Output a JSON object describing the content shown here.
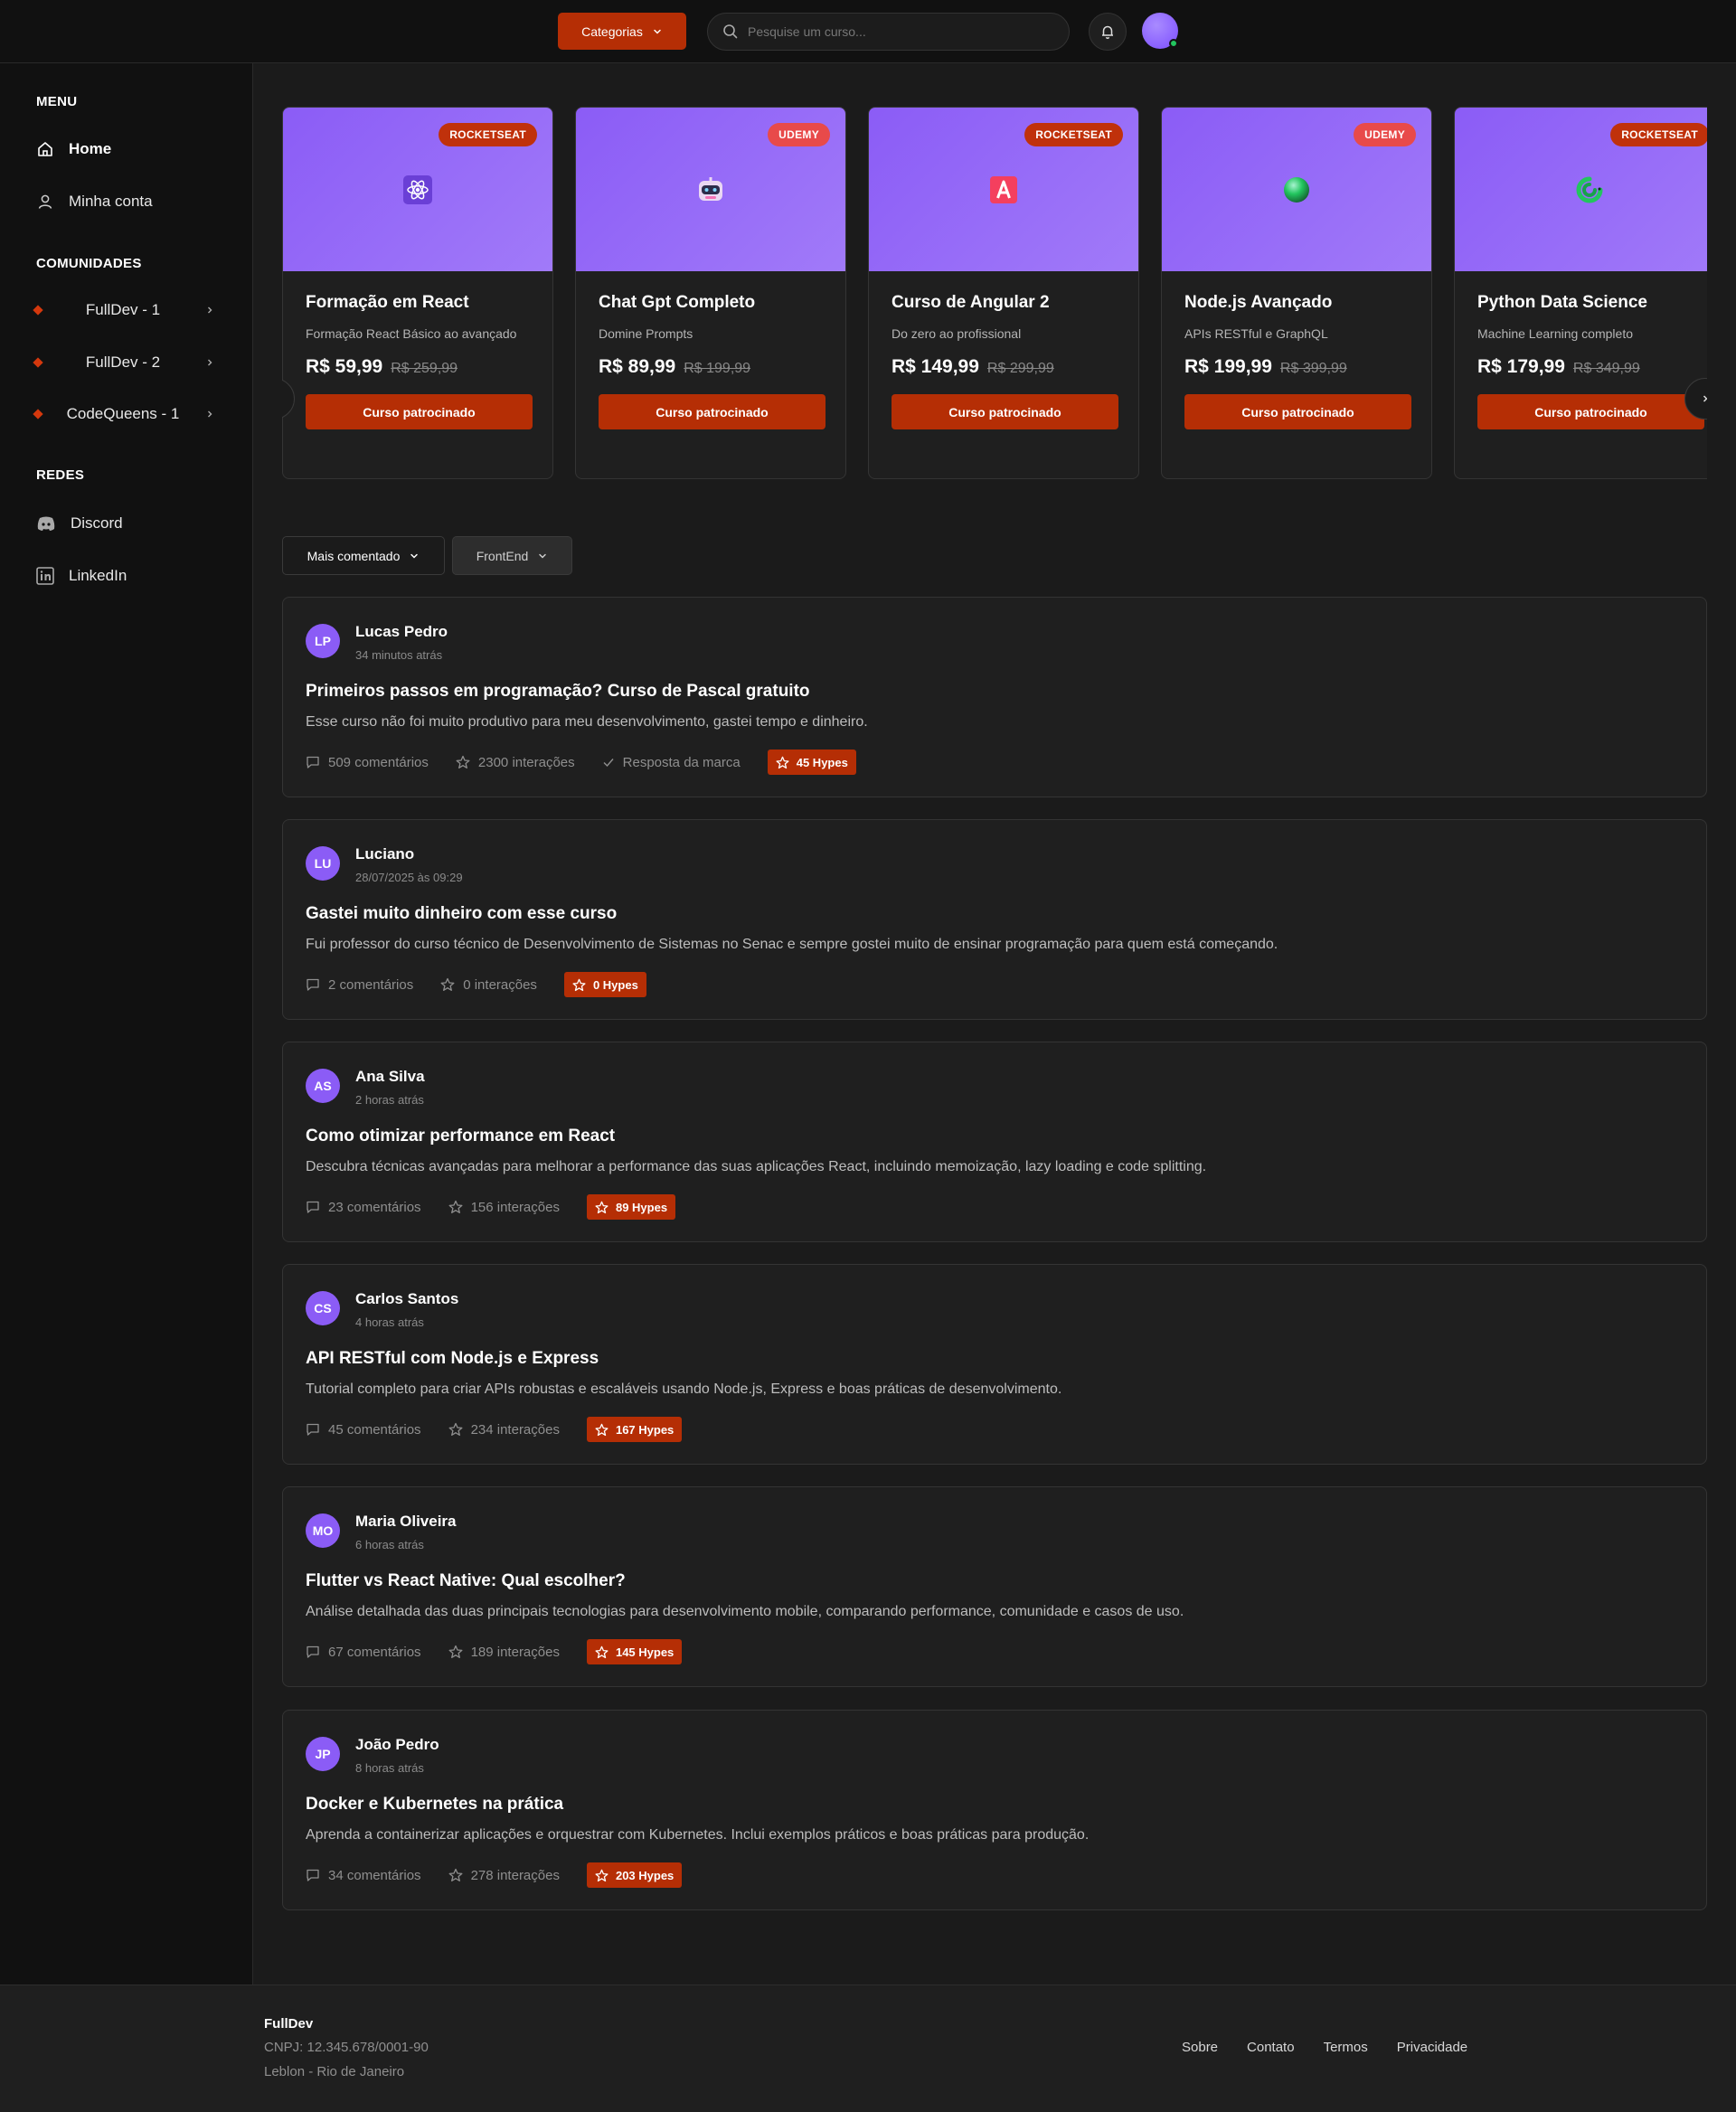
{
  "header": {
    "categories_label": "Categorias",
    "search_placeholder": "Pesquise um curso..."
  },
  "sidebar": {
    "menu_heading": "MENU",
    "menu_items": [
      {
        "label": "Home",
        "icon": "home-icon",
        "active": true
      },
      {
        "label": "Minha conta",
        "icon": "user-icon"
      }
    ],
    "communities_heading": "COMUNIDADES",
    "communities": [
      {
        "label": "FullDev - 1"
      },
      {
        "label": "FullDev - 2"
      },
      {
        "label": "CodeQueens - 1"
      }
    ],
    "networks_heading": "REDES",
    "networks": [
      {
        "label": "Discord",
        "icon": "discord-icon"
      },
      {
        "label": "LinkedIn",
        "icon": "linkedin-icon"
      }
    ]
  },
  "courses": [
    {
      "badge": "ROCKETSEAT",
      "icon": "react-atom-icon",
      "title": "Formação em React",
      "desc": "Formação React Básico ao avançado",
      "price": "R$ 59,99",
      "old_price": "R$ 259,99",
      "cta": "Curso patrocinado"
    },
    {
      "badge": "UDEMY",
      "icon": "robot-icon",
      "title": "Chat Gpt Completo",
      "desc": "Domine Prompts",
      "price": "R$ 89,99",
      "old_price": "R$ 199,99",
      "cta": "Curso patrocinado"
    },
    {
      "badge": "ROCKETSEAT",
      "icon": "angular-icon",
      "title": "Curso de Angular 2",
      "desc": "Do zero ao profissional",
      "price": "R$ 149,99",
      "old_price": "R$ 299,99",
      "cta": "Curso patrocinado"
    },
    {
      "badge": "UDEMY",
      "icon": "green-sphere-icon",
      "title": "Node.js Avançado",
      "desc": "APIs RESTful e GraphQL",
      "price": "R$ 199,99",
      "old_price": "R$ 399,99",
      "cta": "Curso patrocinado"
    },
    {
      "badge": "ROCKETSEAT",
      "icon": "python-snake-icon",
      "title": "Python Data Science",
      "desc": "Machine Learning completo",
      "price": "R$ 179,99",
      "old_price": "R$ 349,99",
      "cta": "Curso patrocinado"
    }
  ],
  "filters": {
    "sort_label": "Mais comentado",
    "category_label": "FrontEnd"
  },
  "posts": [
    {
      "initials": "LP",
      "author": "Lucas Pedro",
      "time": "34 minutos atrás",
      "title": "Primeiros passos em programação? Curso de Pascal gratuito",
      "text": "Esse curso não foi muito produtivo para meu desenvolvimento, gastei tempo e dinheiro.",
      "comments": "509 comentários",
      "interactions": "2300 interações",
      "brand_reply": "Resposta da marca",
      "hypes": "45 Hypes"
    },
    {
      "initials": "LU",
      "author": "Luciano",
      "time": "28/07/2025 às 09:29",
      "title": "Gastei muito dinheiro com esse curso",
      "text": "Fui professor do curso técnico de Desenvolvimento de Sistemas no Senac e sempre gostei muito de ensinar programação para quem está começando.",
      "comments": "2 comentários",
      "interactions": "0 interações",
      "hypes": "0 Hypes"
    },
    {
      "initials": "AS",
      "author": "Ana Silva",
      "time": "2 horas atrás",
      "title": "Como otimizar performance em React",
      "text": "Descubra técnicas avançadas para melhorar a performance das suas aplicações React, incluindo memoização, lazy loading e code splitting.",
      "comments": "23 comentários",
      "interactions": "156 interações",
      "hypes": "89 Hypes"
    },
    {
      "initials": "CS",
      "author": "Carlos Santos",
      "time": "4 horas atrás",
      "title": "API RESTful com Node.js e Express",
      "text": "Tutorial completo para criar APIs robustas e escaláveis usando Node.js, Express e boas práticas de desenvolvimento.",
      "comments": "45 comentários",
      "interactions": "234 interações",
      "hypes": "167 Hypes"
    },
    {
      "initials": "MO",
      "author": "Maria Oliveira",
      "time": "6 horas atrás",
      "title": "Flutter vs React Native: Qual escolher?",
      "text": "Análise detalhada das duas principais tecnologias para desenvolvimento mobile, comparando performance, comunidade e casos de uso.",
      "comments": "67 comentários",
      "interactions": "189 interações",
      "hypes": "145 Hypes"
    },
    {
      "initials": "JP",
      "author": "João Pedro",
      "time": "8 horas atrás",
      "title": "Docker e Kubernetes na prática",
      "text": "Aprenda a containerizar aplicações e orquestrar com Kubernetes. Inclui exemplos práticos e boas práticas para produção.",
      "comments": "34 comentários",
      "interactions": "278 interações",
      "hypes": "203 Hypes"
    }
  ],
  "footer": {
    "brand": "FullDev",
    "cnpj": "CNPJ: 12.345.678/0001-90",
    "location": "Leblon - Rio de Janeiro",
    "links": [
      "Sobre",
      "Contato",
      "Termos",
      "Privacidade"
    ]
  },
  "colors": {
    "accent": "#b52e05",
    "udemy_badge": "#e84a4a",
    "card_purple": "#8b5cf6",
    "online": "#22c55e"
  }
}
